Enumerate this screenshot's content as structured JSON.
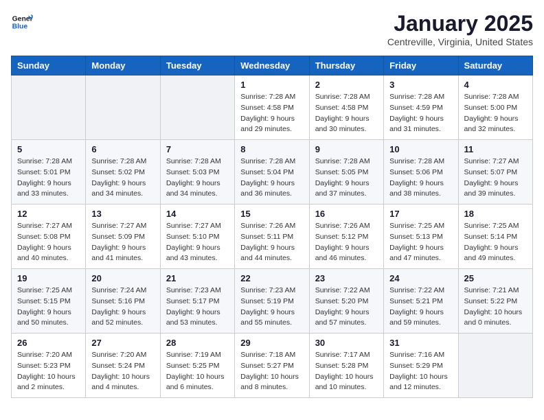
{
  "header": {
    "logo_line1": "General",
    "logo_line2": "Blue",
    "month": "January 2025",
    "location": "Centreville, Virginia, United States"
  },
  "weekdays": [
    "Sunday",
    "Monday",
    "Tuesday",
    "Wednesday",
    "Thursday",
    "Friday",
    "Saturday"
  ],
  "weeks": [
    [
      {
        "day": "",
        "info": ""
      },
      {
        "day": "",
        "info": ""
      },
      {
        "day": "",
        "info": ""
      },
      {
        "day": "1",
        "info": "Sunrise: 7:28 AM\nSunset: 4:58 PM\nDaylight: 9 hours\nand 29 minutes."
      },
      {
        "day": "2",
        "info": "Sunrise: 7:28 AM\nSunset: 4:58 PM\nDaylight: 9 hours\nand 30 minutes."
      },
      {
        "day": "3",
        "info": "Sunrise: 7:28 AM\nSunset: 4:59 PM\nDaylight: 9 hours\nand 31 minutes."
      },
      {
        "day": "4",
        "info": "Sunrise: 7:28 AM\nSunset: 5:00 PM\nDaylight: 9 hours\nand 32 minutes."
      }
    ],
    [
      {
        "day": "5",
        "info": "Sunrise: 7:28 AM\nSunset: 5:01 PM\nDaylight: 9 hours\nand 33 minutes."
      },
      {
        "day": "6",
        "info": "Sunrise: 7:28 AM\nSunset: 5:02 PM\nDaylight: 9 hours\nand 34 minutes."
      },
      {
        "day": "7",
        "info": "Sunrise: 7:28 AM\nSunset: 5:03 PM\nDaylight: 9 hours\nand 34 minutes."
      },
      {
        "day": "8",
        "info": "Sunrise: 7:28 AM\nSunset: 5:04 PM\nDaylight: 9 hours\nand 36 minutes."
      },
      {
        "day": "9",
        "info": "Sunrise: 7:28 AM\nSunset: 5:05 PM\nDaylight: 9 hours\nand 37 minutes."
      },
      {
        "day": "10",
        "info": "Sunrise: 7:28 AM\nSunset: 5:06 PM\nDaylight: 9 hours\nand 38 minutes."
      },
      {
        "day": "11",
        "info": "Sunrise: 7:27 AM\nSunset: 5:07 PM\nDaylight: 9 hours\nand 39 minutes."
      }
    ],
    [
      {
        "day": "12",
        "info": "Sunrise: 7:27 AM\nSunset: 5:08 PM\nDaylight: 9 hours\nand 40 minutes."
      },
      {
        "day": "13",
        "info": "Sunrise: 7:27 AM\nSunset: 5:09 PM\nDaylight: 9 hours\nand 41 minutes."
      },
      {
        "day": "14",
        "info": "Sunrise: 7:27 AM\nSunset: 5:10 PM\nDaylight: 9 hours\nand 43 minutes."
      },
      {
        "day": "15",
        "info": "Sunrise: 7:26 AM\nSunset: 5:11 PM\nDaylight: 9 hours\nand 44 minutes."
      },
      {
        "day": "16",
        "info": "Sunrise: 7:26 AM\nSunset: 5:12 PM\nDaylight: 9 hours\nand 46 minutes."
      },
      {
        "day": "17",
        "info": "Sunrise: 7:25 AM\nSunset: 5:13 PM\nDaylight: 9 hours\nand 47 minutes."
      },
      {
        "day": "18",
        "info": "Sunrise: 7:25 AM\nSunset: 5:14 PM\nDaylight: 9 hours\nand 49 minutes."
      }
    ],
    [
      {
        "day": "19",
        "info": "Sunrise: 7:25 AM\nSunset: 5:15 PM\nDaylight: 9 hours\nand 50 minutes."
      },
      {
        "day": "20",
        "info": "Sunrise: 7:24 AM\nSunset: 5:16 PM\nDaylight: 9 hours\nand 52 minutes."
      },
      {
        "day": "21",
        "info": "Sunrise: 7:23 AM\nSunset: 5:17 PM\nDaylight: 9 hours\nand 53 minutes."
      },
      {
        "day": "22",
        "info": "Sunrise: 7:23 AM\nSunset: 5:19 PM\nDaylight: 9 hours\nand 55 minutes."
      },
      {
        "day": "23",
        "info": "Sunrise: 7:22 AM\nSunset: 5:20 PM\nDaylight: 9 hours\nand 57 minutes."
      },
      {
        "day": "24",
        "info": "Sunrise: 7:22 AM\nSunset: 5:21 PM\nDaylight: 9 hours\nand 59 minutes."
      },
      {
        "day": "25",
        "info": "Sunrise: 7:21 AM\nSunset: 5:22 PM\nDaylight: 10 hours\nand 0 minutes."
      }
    ],
    [
      {
        "day": "26",
        "info": "Sunrise: 7:20 AM\nSunset: 5:23 PM\nDaylight: 10 hours\nand 2 minutes."
      },
      {
        "day": "27",
        "info": "Sunrise: 7:20 AM\nSunset: 5:24 PM\nDaylight: 10 hours\nand 4 minutes."
      },
      {
        "day": "28",
        "info": "Sunrise: 7:19 AM\nSunset: 5:25 PM\nDaylight: 10 hours\nand 6 minutes."
      },
      {
        "day": "29",
        "info": "Sunrise: 7:18 AM\nSunset: 5:27 PM\nDaylight: 10 hours\nand 8 minutes."
      },
      {
        "day": "30",
        "info": "Sunrise: 7:17 AM\nSunset: 5:28 PM\nDaylight: 10 hours\nand 10 minutes."
      },
      {
        "day": "31",
        "info": "Sunrise: 7:16 AM\nSunset: 5:29 PM\nDaylight: 10 hours\nand 12 minutes."
      },
      {
        "day": "",
        "info": ""
      }
    ]
  ]
}
